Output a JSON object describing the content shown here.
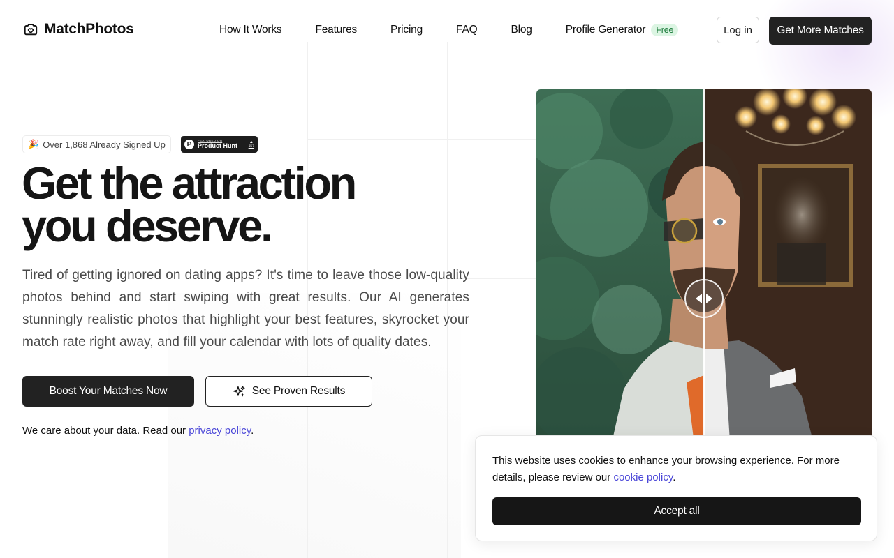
{
  "brand": {
    "name": "MatchPhotos",
    "logo_icon": "camera-heart-icon"
  },
  "nav": {
    "items": [
      {
        "label": "How It Works"
      },
      {
        "label": "Features"
      },
      {
        "label": "Pricing"
      },
      {
        "label": "FAQ"
      },
      {
        "label": "Blog"
      },
      {
        "label": "Profile Generator",
        "badge": "Free"
      }
    ],
    "login_label": "Log in",
    "cta_label": "Get More Matches"
  },
  "hero": {
    "signup_badge": {
      "emoji": "🎉",
      "text": "Over 1,868 Already Signed Up"
    },
    "product_hunt": {
      "small_text": "FEATURED ON",
      "name": "Product Hunt",
      "letter": "P",
      "votes": "157"
    },
    "headline_line1": "Get the attraction",
    "headline_line2": "you deserve.",
    "description": "Tired of getting ignored on dating apps? It's time to leave those low-quality photos behind and start swiping with great results. Our AI generates stunningly realistic photos that highlight your best features, skyrocket your match rate right away, and fill your calendar with lots of quality dates.",
    "primary_cta": "Boost Your Matches Now",
    "secondary_cta": "See Proven Results",
    "secondary_cta_icon": "sparkles-icon",
    "privacy_prefix": "We care about your data. Read our ",
    "privacy_link": "privacy policy",
    "privacy_suffix": "."
  },
  "comparison": {
    "slider_position": 0.5,
    "handle_icon": "left-right-arrows-icon"
  },
  "cookie_banner": {
    "text": "This website uses cookies to enhance your browsing experience. For more details, please review our ",
    "link": "cookie policy",
    "suffix": ".",
    "accept_label": "Accept all"
  },
  "colors": {
    "primary_dark": "#222222",
    "link": "#4a46d8",
    "free_badge_bg": "#dcf5e3",
    "free_badge_text": "#1a7a3a"
  }
}
